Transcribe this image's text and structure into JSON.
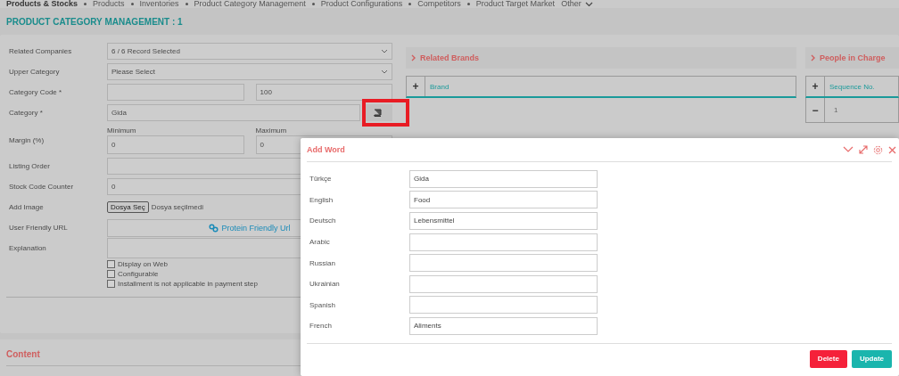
{
  "nav": {
    "section": "Products & Stocks",
    "links": [
      {
        "label": "Products"
      },
      {
        "label": "Inventories"
      },
      {
        "label": "Product Category Management"
      },
      {
        "label": "Product Configurations"
      },
      {
        "label": "Competitors"
      },
      {
        "label": "Product Target Market"
      }
    ],
    "more": "Other"
  },
  "page_title": "PRODUCT CATEGORY MANAGEMENT : 1",
  "form": {
    "fields": [
      {
        "kind": "select",
        "label": "Related Companies",
        "value": "6 / 6 Record Selected"
      },
      {
        "kind": "select",
        "label": "Upper Category",
        "value": "Please Select"
      },
      {
        "kind": "pair",
        "label": "Category Code *",
        "value_2": "100"
      },
      {
        "kind": "button",
        "label": "Category *",
        "value": "Gida",
        "highlighted": true
      },
      {
        "kind": "range",
        "label": "Margin (%)",
        "min_label": "Minimum",
        "value": "0",
        "max_label": "Maximum",
        "value_2": "0"
      },
      {
        "kind": "text",
        "label": "Listing Order"
      },
      {
        "kind": "text",
        "label": "Stock Code Counter",
        "value": "0"
      },
      {
        "kind": "file",
        "label": "Add Image",
        "button": "Dosya Seç",
        "value": "Dosya seçilmedi"
      },
      {
        "kind": "link",
        "label": "User Friendly URL",
        "value": "Protein Friendly Url"
      },
      {
        "kind": "textarea",
        "label": "Explanation"
      }
    ],
    "checkboxes": [
      {
        "label": "Display on Web",
        "checked": false
      },
      {
        "label": "Configurable",
        "checked": false
      },
      {
        "label": "Installment is not applicable in payment step",
        "checked": false
      }
    ]
  },
  "related_brands": {
    "title": "Related Brands",
    "add": "+",
    "column": "Brand"
  },
  "people_in_charge": {
    "title": "People in Charge",
    "add": "+",
    "column": "Sequence No.",
    "rows": [
      {
        "remove": "−",
        "cell": "1"
      }
    ]
  },
  "content": {
    "title": "Content"
  },
  "dialog": {
    "title": "Add Word",
    "fields": [
      {
        "label": "Türkçe",
        "value": "Gida"
      },
      {
        "label": "English",
        "value": "Food"
      },
      {
        "label": "Deutsch",
        "value": "Lebensmittel"
      },
      {
        "label": "Arabic"
      },
      {
        "label": "Russian"
      },
      {
        "label": "Ukrainian"
      },
      {
        "label": "Spanish"
      },
      {
        "label": "French",
        "value": "Aliments"
      }
    ],
    "buttons": [
      {
        "label": "Delete",
        "kind": "danger"
      },
      {
        "label": "Update",
        "kind": "primary"
      }
    ]
  }
}
